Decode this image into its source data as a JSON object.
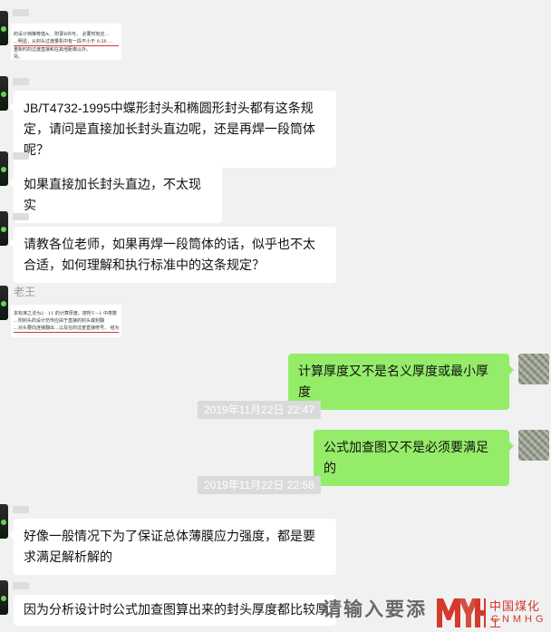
{
  "messages": [
    {
      "side": "left",
      "type": "image",
      "sender": "",
      "image_lines": [
        "的设计…表 …",
        "的设计档推荐值A。 附录B许可。 必要时有应…",
        "…明显，从封头过渡量机中有一段不小于 0.5δ …",
        "重新时的过渡直接和在其他距离以外。",
        "另。"
      ]
    },
    {
      "side": "left",
      "type": "text",
      "sender": "",
      "text": "JB/T4732-1995中蝶形封头和椭圆形封头都有这条规定，请问是直接加长封头直边呢，还是再焊一段筒体呢？"
    },
    {
      "side": "left",
      "type": "text",
      "sender": "",
      "text": "如果直接加长封头直边，不太现实"
    },
    {
      "side": "left",
      "type": "text",
      "sender": "",
      "text": "请教各位老师，如果再焊一段筒体的话，似乎也不太合适，如何理解和执行标准中的这条规定？"
    },
    {
      "side": "left",
      "type": "image",
      "sender": "老王",
      "image_lines": [
        "本标准之法为2 · 11 的计算厚度。按所T—1 中类数",
        "…附封头的设计仿传应由于直接的封头或封翻",
        "…对头要向连接翻出…以及在的过度直接修号， 结为 5"
      ]
    },
    {
      "side": "right",
      "type": "text",
      "text": "计算厚度又不是名义厚度或最小厚度"
    },
    {
      "type": "time",
      "text": "2019年11月22日 22:47"
    },
    {
      "side": "right",
      "type": "text",
      "text": "公式加查图又不是必须要满足的"
    },
    {
      "type": "time",
      "text": "2019年11月22日 22:58"
    },
    {
      "side": "left",
      "type": "text",
      "sender": "",
      "text": "好像一般情况下为了保证总体薄膜应力强度，都是要求满足解析解的"
    },
    {
      "side": "left",
      "type": "text",
      "sender": "",
      "text": "因为分析设计时公式加查图算出来的封头厚度都比较厚"
    }
  ],
  "watermark": {
    "text": "请输入要添"
  },
  "logo": {
    "cn": "中国煤化工",
    "en": "CNMHG",
    "mark": "MYH"
  },
  "colors": {
    "background": "#f1f1f1",
    "bubble_left": "#ffffff",
    "bubble_right": "#95ec69",
    "logo": "#d23a2c"
  }
}
